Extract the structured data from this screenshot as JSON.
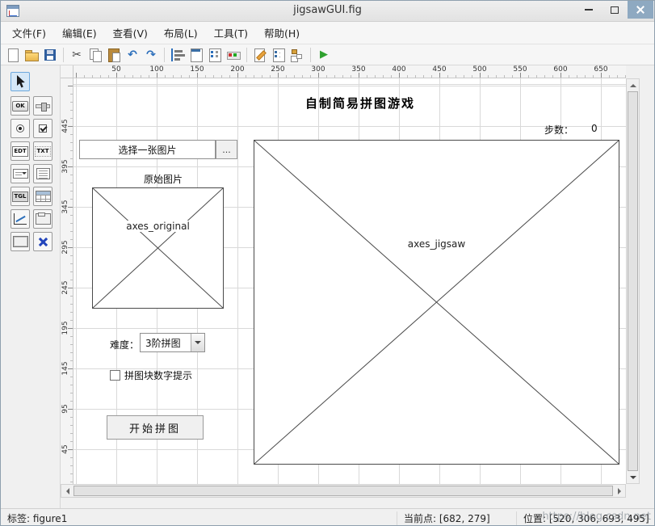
{
  "window": {
    "title": "jigsawGUI.fig"
  },
  "menubar": {
    "items": [
      "文件(F)",
      "编辑(E)",
      "查看(V)",
      "布局(L)",
      "工具(T)",
      "帮助(H)"
    ]
  },
  "toolbar": {
    "buttons": [
      "new",
      "open",
      "save",
      "cut",
      "copy",
      "paste",
      "undo",
      "redo",
      "align-objects",
      "menu-editor",
      "tab-order-editor",
      "toolbar-editor",
      "editor",
      "property-inspector",
      "object-browser",
      "run"
    ],
    "glyphs": {
      "cut": "✂",
      "undo": "↶",
      "redo": "↷",
      "run": "▶"
    }
  },
  "palette": {
    "push_button_label": "OK",
    "edit_label": "EDT",
    "static_label": "TXT",
    "toggle_label": "TGL"
  },
  "rulers": {
    "horizontal": [
      "50",
      "100",
      "150",
      "200",
      "250",
      "300",
      "350",
      "400",
      "450",
      "500",
      "550",
      "600",
      "650"
    ],
    "vertical": [
      "445",
      "395",
      "345",
      "295",
      "245",
      "195",
      "145",
      "95",
      "45"
    ]
  },
  "canvas": {
    "title": "自制简易拼图游戏",
    "steps_label": "步数：",
    "steps_value": "0",
    "image_edit_value": "选择一张图片",
    "browse_label": "...",
    "original_label": "原始图片",
    "axes_original_label": "axes_original",
    "axes_jigsaw_label": "axes_jigsaw",
    "difficulty_label": "难度：",
    "difficulty_value": "3阶拼图",
    "hint_checkbox_label": "拼图块数字提示",
    "start_button_label": "开始拼图"
  },
  "statusbar": {
    "tag": "标签: figure1",
    "current_point": "当前点: [682, 279]",
    "position": "位置: [520, 306, 693, 495]"
  },
  "watermark": "https://blog.csdn.net",
  "colors": {
    "selection-blue": "#6da8dc",
    "selection-bg": "#d6e8f7",
    "run-green": "#2fa12f",
    "close-bg": "#8ea9c1",
    "grid": "#d9d9d9"
  }
}
